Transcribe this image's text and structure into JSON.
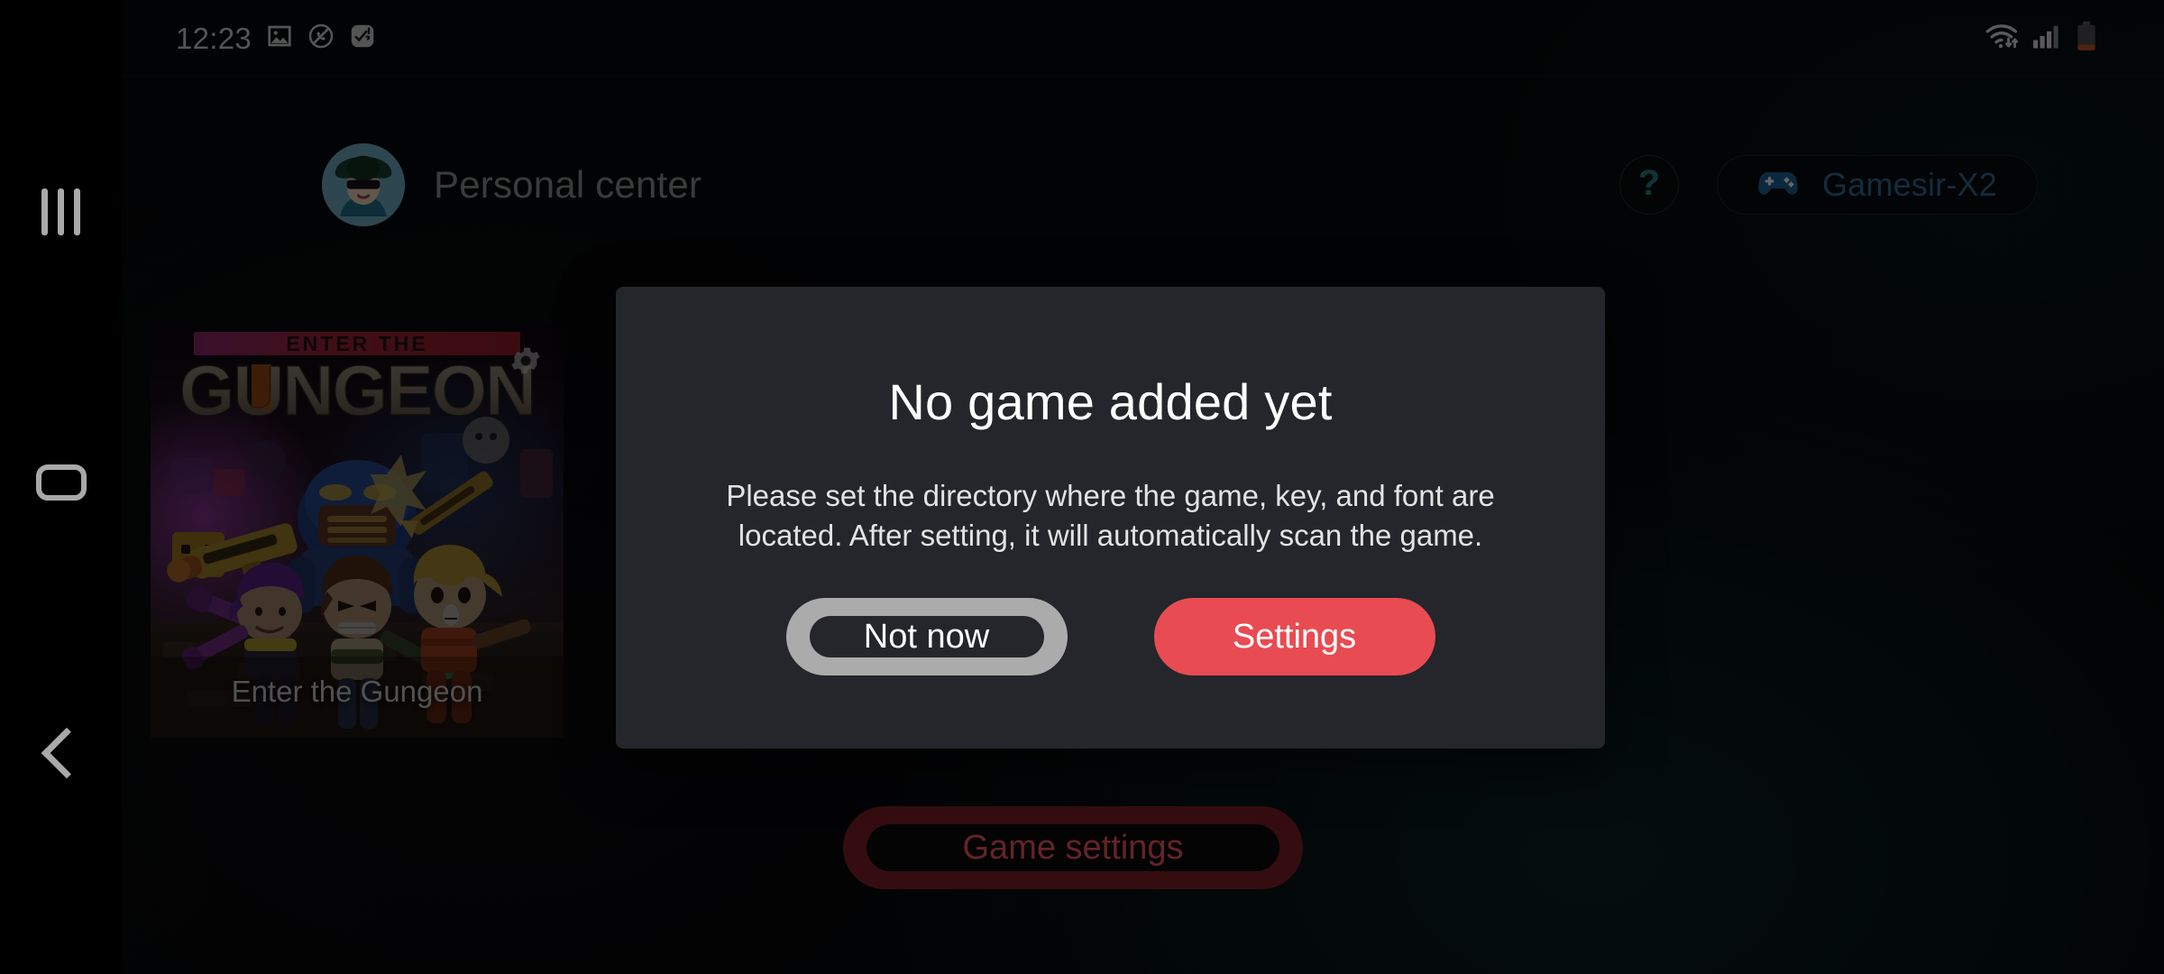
{
  "statusbar": {
    "clock": "12:23",
    "left_icons": [
      "image-icon",
      "call-muted-icon",
      "check-alert-icon"
    ],
    "right_icons": [
      "wifi-icon",
      "cellular-signal-icon",
      "battery-low-icon"
    ],
    "battery_color": "#c2502a"
  },
  "navrail": {
    "recents_label": "recents-icon",
    "home_label": "home-icon",
    "back_label": "back-icon"
  },
  "header": {
    "profile_name": "Personal center",
    "avatar_label": "avatar",
    "help_label": "?",
    "device_label": "Gamesir-X2",
    "device_icon": "gamepad-icon",
    "accent_teal": "#1f7f88",
    "accent_blue": "#2d6a94"
  },
  "game_card": {
    "title": "Enter the Gungeon",
    "logo_top": "ENTER THE",
    "logo_main": "GUNGEON",
    "gear_label": "gear-icon"
  },
  "dialog": {
    "title": "No game added yet",
    "message": "Please set the directory where the game, key, and font are located. After setting, it will automatically scan the game.",
    "not_now_label": "Not now",
    "settings_label": "Settings",
    "settings_color": "#e94b52",
    "not_now_color": "#ababab",
    "surface_color": "#24262b"
  },
  "bottom": {
    "game_settings_label": "Game settings",
    "ring_color": "#7e2027",
    "text_color": "#f0555d"
  }
}
